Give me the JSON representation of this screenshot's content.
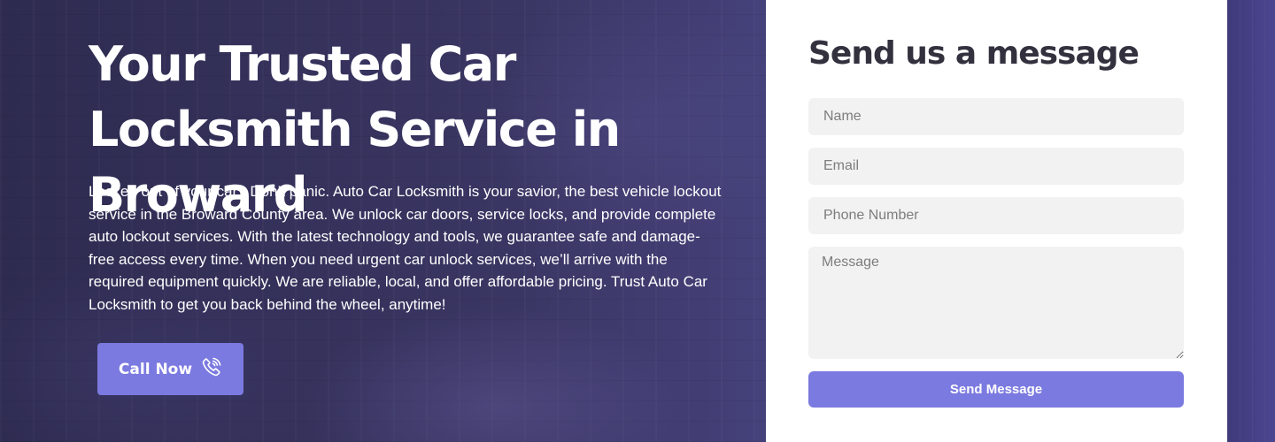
{
  "hero": {
    "headline": "Your Trusted Car Locksmith Service in Broward",
    "intro": "Locked out of your car? Don’t panic. Auto Car Locksmith is your savior, the best vehicle lockout service in the Broward County area. We unlock car doors, service locks, and provide complete auto lockout services. With the latest technology and tools, we guarantee safe and damage-free access every time. When you need urgent car unlock services, we’ll arrive with the required equipment quickly. We are reliable, local, and offer affordable pricing. Trust Auto Car Locksmith to get you back behind the wheel, anytime!",
    "call_label": "Call Now",
    "call_icon": "phone-ringing-icon"
  },
  "form": {
    "title": "Send us a message",
    "name_placeholder": "Name",
    "email_placeholder": "Email",
    "phone_placeholder": "Phone Number",
    "message_placeholder": "Message",
    "submit_label": "Send Message"
  },
  "colors": {
    "accent": "#7b7ae0",
    "hero_overlay": "#3a3663",
    "form_bg": "#ffffff",
    "field_bg": "#f2f2f2",
    "title_text": "#34313f"
  }
}
